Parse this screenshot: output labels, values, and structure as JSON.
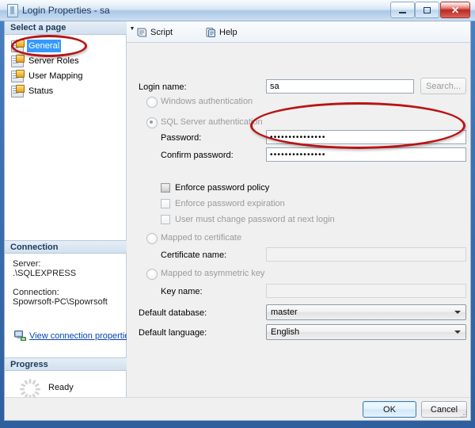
{
  "window": {
    "title": "Login Properties - sa",
    "icon": "document-icon",
    "controls": {
      "minimize": "minimize-icon",
      "maximize": "maximize-icon",
      "close": "close-icon"
    }
  },
  "toolbar": {
    "script_label": "Script",
    "script_icon": "script-icon",
    "script_dropdown": "▼",
    "help_label": "Help",
    "help_icon": "help-icon"
  },
  "sidebar": {
    "select_page_header": "Select a page",
    "pages": [
      {
        "label": "General",
        "selected": true
      },
      {
        "label": "Server Roles",
        "selected": false
      },
      {
        "label": "User Mapping",
        "selected": false
      },
      {
        "label": "Status",
        "selected": false
      }
    ],
    "connection_header": "Connection",
    "server_caption": "Server:",
    "server_value": ".\\SQLEXPRESS",
    "connection_caption": "Connection:",
    "connection_value": "Spowrsoft-PC\\Spowrsoft",
    "view_connection_link": "View connection properties",
    "view_connection_icon": "network-computer-icon",
    "progress_header": "Progress",
    "progress_status": "Ready",
    "progress_icon": "spinner-icon"
  },
  "form": {
    "login_name_label": "Login name:",
    "login_name_value": "sa",
    "search_button": "Search...",
    "windows_auth_label": "Windows authentication",
    "windows_auth_selected": false,
    "sql_auth_label": "SQL Server authentication",
    "sql_auth_selected": true,
    "password_label": "Password:",
    "password_value": "•••••••••••••••",
    "confirm_password_label": "Confirm password:",
    "confirm_password_value": "•••••••••••••••",
    "enforce_policy_label": "Enforce password policy",
    "enforce_policy_checked": false,
    "enforce_expiration_label": "Enforce password expiration",
    "enforce_expiration_checked": false,
    "must_change_label": "User must change password at next login",
    "must_change_checked": false,
    "mapped_cert_label": "Mapped to certificate",
    "certificate_name_label": "Certificate name:",
    "certificate_name_value": "",
    "mapped_key_label": "Mapped to asymmetric key",
    "key_name_label": "Key name:",
    "key_name_value": "",
    "default_database_label": "Default database:",
    "default_database_value": "master",
    "default_language_label": "Default language:",
    "default_language_value": "English"
  },
  "buttons": {
    "ok": "OK",
    "cancel": "Cancel"
  },
  "annotations": {
    "general_highlight": "red-ellipse-around-general",
    "password_highlight": "red-ellipse-around-password-fields"
  },
  "colors": {
    "accent": "#3399ff",
    "annotation": "#b81414",
    "link": "#0645ad",
    "titlebar": "#cfe0f2"
  }
}
